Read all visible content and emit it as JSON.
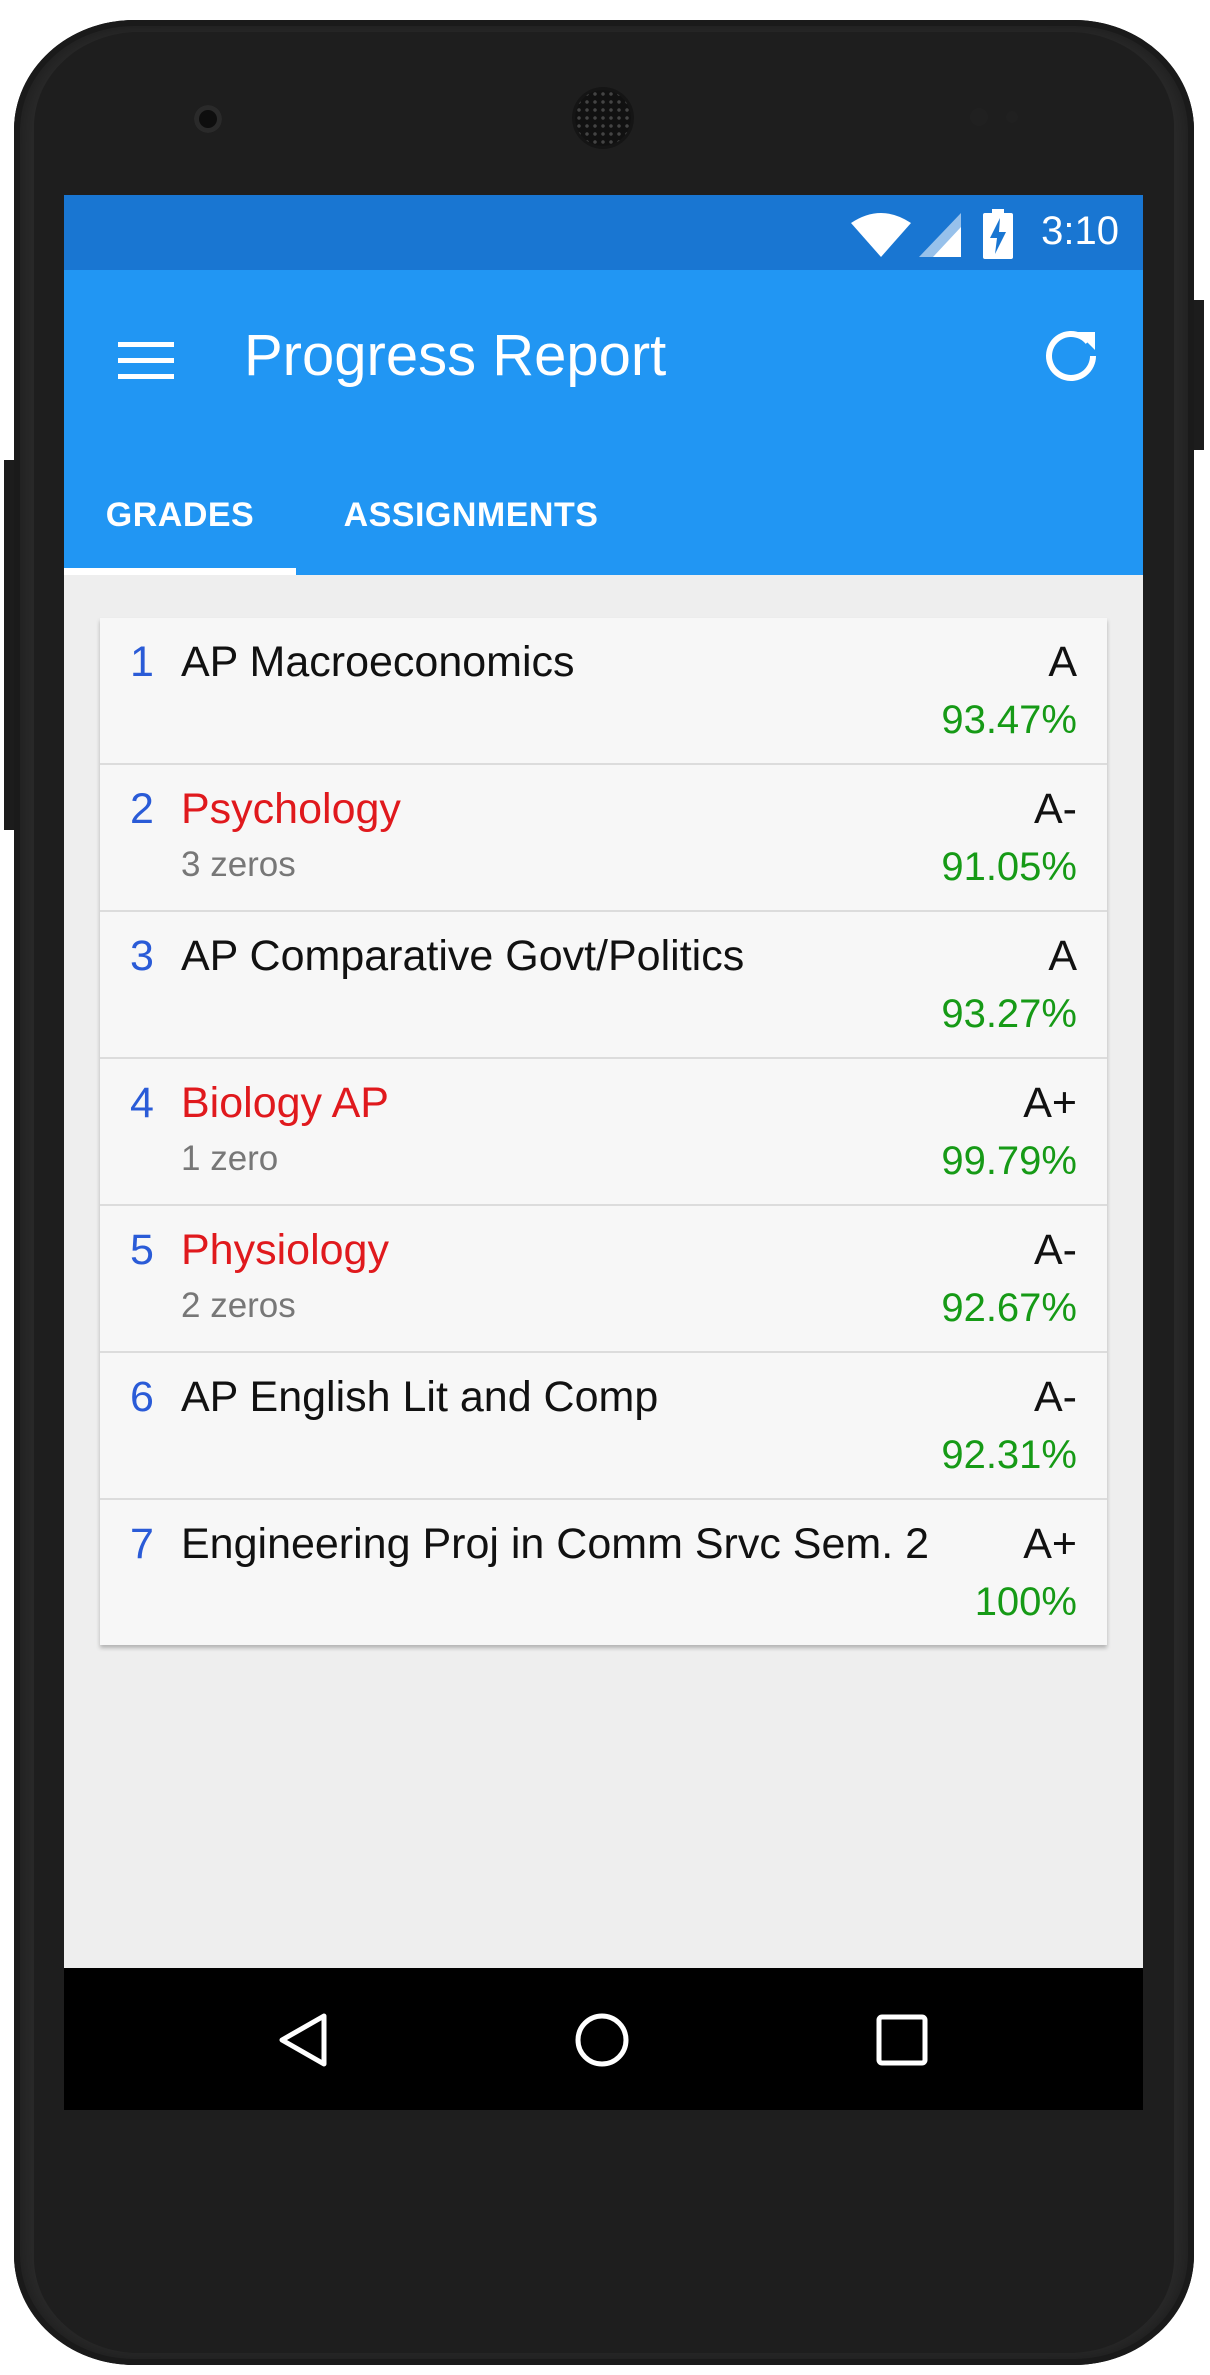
{
  "status_bar": {
    "time": "3:10"
  },
  "app_bar": {
    "title": "Progress Report"
  },
  "tabs": [
    {
      "label": "GRADES",
      "selected": true
    },
    {
      "label": "ASSIGNMENTS",
      "selected": false
    }
  ],
  "courses": [
    {
      "num": "1",
      "name": "AP Macroeconomics",
      "zeros": "",
      "grade": "A",
      "percent": "93.47%",
      "flagged": false
    },
    {
      "num": "2",
      "name": "Psychology",
      "zeros": "3 zeros",
      "grade": "A-",
      "percent": "91.05%",
      "flagged": true
    },
    {
      "num": "3",
      "name": "AP Comparative Govt/Politics",
      "zeros": "",
      "grade": "A",
      "percent": "93.27%",
      "flagged": false
    },
    {
      "num": "4",
      "name": "Biology AP",
      "zeros": "1 zero",
      "grade": "A+",
      "percent": "99.79%",
      "flagged": true
    },
    {
      "num": "5",
      "name": "Physiology",
      "zeros": "2 zeros",
      "grade": "A-",
      "percent": "92.67%",
      "flagged": true
    },
    {
      "num": "6",
      "name": "AP English Lit and Comp",
      "zeros": "",
      "grade": "A-",
      "percent": "92.31%",
      "flagged": false
    },
    {
      "num": "7",
      "name": "Engineering Proj in Comm Srvc Sem. 2",
      "zeros": "",
      "grade": "A+",
      "percent": "100%",
      "flagged": false
    }
  ],
  "colors": {
    "status_bar": "#1976d2",
    "app_bar": "#2196f3",
    "course_number": "#2a5bd7",
    "flagged_course": "#e0191d",
    "percent": "#169a16"
  },
  "icons": [
    "menu-icon",
    "refresh-icon",
    "wifi-icon",
    "signal-icon",
    "battery-charging-icon",
    "back-icon",
    "home-icon",
    "recents-icon"
  ]
}
